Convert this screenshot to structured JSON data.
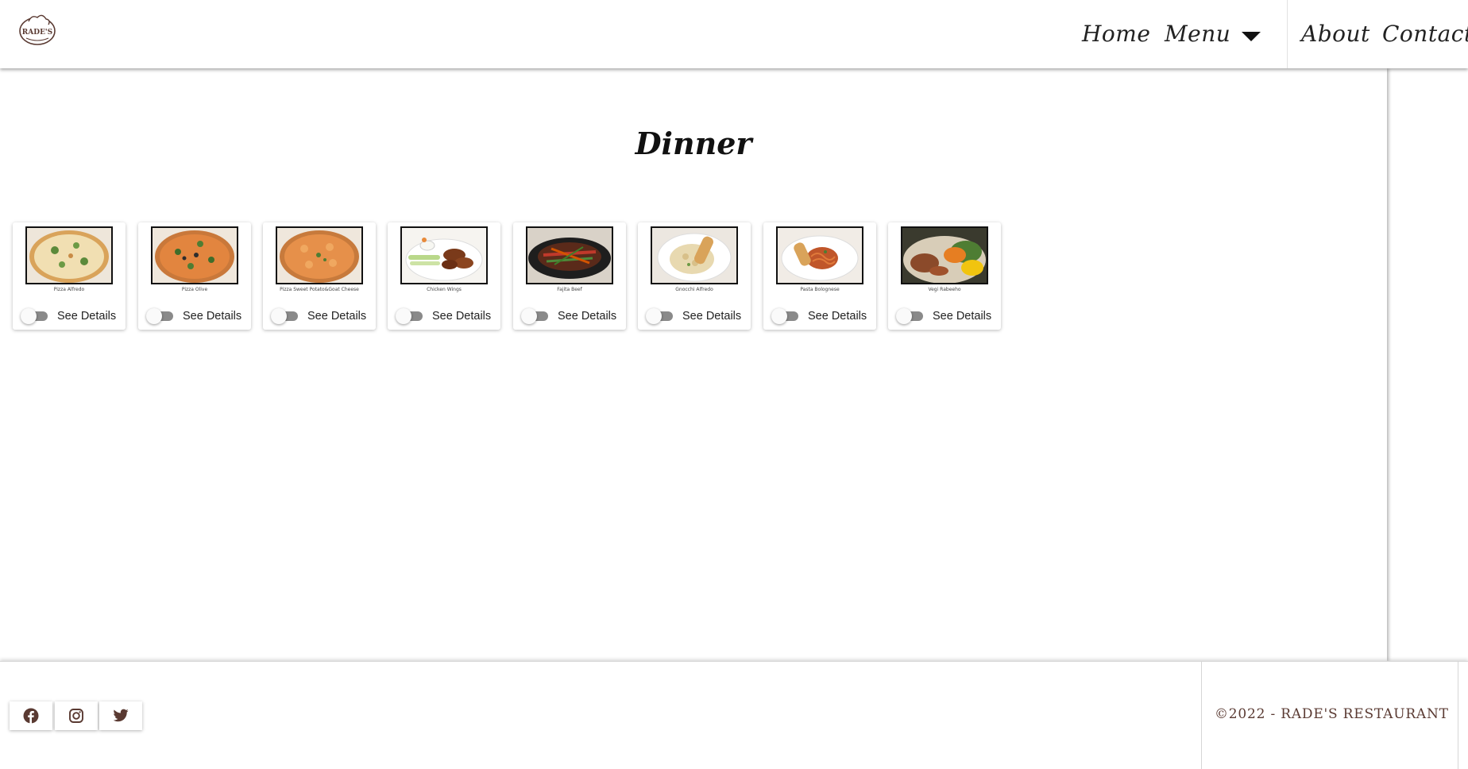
{
  "header": {
    "logo_text": "RADE'S",
    "nav": {
      "home": "Home",
      "menu": "Menu",
      "about": "About",
      "contact": "Contact"
    }
  },
  "main": {
    "title": "Dinner",
    "see_details_label": "See Details",
    "dishes": [
      {
        "name": "Pizza Alfredo"
      },
      {
        "name": "Pizza Olive"
      },
      {
        "name": "Pizza Sweet Potato&Goat Cheese"
      },
      {
        "name": "Chicken Wings"
      },
      {
        "name": "Fajita Beef"
      },
      {
        "name": "Gnocchi Alfredo"
      },
      {
        "name": "Pasta Bolognese"
      },
      {
        "name": "Vegi Rabeeho"
      }
    ]
  },
  "footer": {
    "social": [
      "facebook-icon",
      "instagram-icon",
      "twitter-icon"
    ],
    "copyright": "©2022 - RADE'S RESTAURANT"
  },
  "colors": {
    "brand_brown": "#5a3a32",
    "toggle_track": "#8a8a8a",
    "text_dark": "#222222"
  }
}
